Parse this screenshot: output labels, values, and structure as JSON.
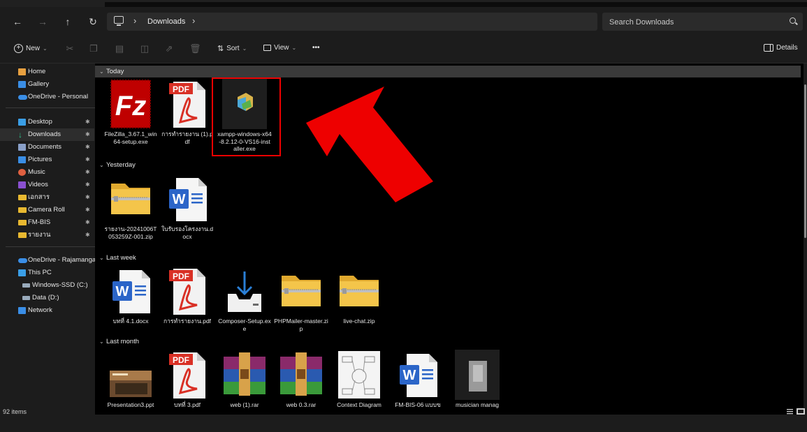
{
  "address": {
    "location_icon": "pc-icon",
    "path": [
      "Downloads"
    ]
  },
  "search": {
    "placeholder": "Search Downloads"
  },
  "commands": {
    "new": "New",
    "sort": "Sort",
    "view": "View",
    "more": "•••",
    "details": "Details"
  },
  "sidebar": {
    "items": [
      {
        "label": "Home",
        "icon": "home-icon",
        "color": "#e8a040"
      },
      {
        "label": "Gallery",
        "icon": "gallery-icon",
        "color": "#3a8ee6"
      },
      {
        "label": "OneDrive - Personal",
        "icon": "cloud-icon",
        "color": "#3a8ee6"
      },
      {
        "label": "Desktop",
        "icon": "desktop-icon",
        "color": "#3a9ee6",
        "pinned": true
      },
      {
        "label": "Downloads",
        "icon": "download-icon",
        "color": "#2dc48a",
        "pinned": true,
        "selected": true
      },
      {
        "label": "Documents",
        "icon": "document-icon",
        "color": "#8aa0c8",
        "pinned": true
      },
      {
        "label": "Pictures",
        "icon": "pictures-icon",
        "color": "#3a8ee6",
        "pinned": true
      },
      {
        "label": "Music",
        "icon": "music-icon",
        "color": "#e06040",
        "pinned": true
      },
      {
        "label": "Videos",
        "icon": "videos-icon",
        "color": "#8a50d0",
        "pinned": true
      },
      {
        "label": "เอกสาร",
        "icon": "folder-icon",
        "color": "#e8b830",
        "pinned": true
      },
      {
        "label": "Camera Roll",
        "icon": "folder-icon",
        "color": "#e8b830",
        "pinned": true
      },
      {
        "label": "FM-BIS",
        "icon": "folder-icon",
        "color": "#e8b830",
        "pinned": true
      },
      {
        "label": "รายงาน",
        "icon": "folder-icon",
        "color": "#e8b830",
        "pinned": true
      },
      {
        "label": "OneDrive - Rajamangal",
        "icon": "cloud-icon",
        "color": "#3a8ee6"
      },
      {
        "label": "This PC",
        "icon": "pc-icon",
        "color": "#3a9ee6"
      },
      {
        "label": "Windows-SSD (C:)",
        "icon": "drive-icon",
        "color": "#9ab"
      },
      {
        "label": "Data (D:)",
        "icon": "drive-icon",
        "color": "#9ab"
      },
      {
        "label": "Network",
        "icon": "network-icon",
        "color": "#3a8ee6"
      }
    ]
  },
  "groups": [
    {
      "label": "Today",
      "files": [
        {
          "name": "FileZilla_3.67.1_win64-setup.exe",
          "type": "filezilla"
        },
        {
          "name": "การทำรายงาน (1).pdf",
          "type": "pdf"
        },
        {
          "name": "xampp-windows-x64-8.2.12-0-VS16-installer.exe",
          "type": "xampp"
        }
      ]
    },
    {
      "label": "Yesterday",
      "files": [
        {
          "name": "รายงาน-20241006T053259Z-001.zip",
          "type": "zip"
        },
        {
          "name": "ใบรับรองโครงงาน.docx",
          "type": "word"
        }
      ]
    },
    {
      "label": "Last week",
      "files": [
        {
          "name": "บทที่ 4.1.docx",
          "type": "word"
        },
        {
          "name": "การทำรายงาน.pdf",
          "type": "pdf"
        },
        {
          "name": "Composer-Setup.exe",
          "type": "composer"
        },
        {
          "name": "PHPMailer-master.zip",
          "type": "zip"
        },
        {
          "name": "live-chat.zip",
          "type": "zip"
        }
      ]
    },
    {
      "label": "Last month",
      "files": [
        {
          "name": "Presentation3.ppt",
          "type": "ppt"
        },
        {
          "name": "บทที่ 3.pdf",
          "type": "pdf"
        },
        {
          "name": "web (1).rar",
          "type": "rar"
        },
        {
          "name": "web 0.3.rar",
          "type": "rar"
        },
        {
          "name": "Context Diagram",
          "type": "diagram"
        },
        {
          "name": "FM-BIS-06 แบบข",
          "type": "word"
        },
        {
          "name": "musician manag",
          "type": "generic"
        }
      ]
    }
  ],
  "status": {
    "count": "92 items"
  },
  "annotation": {
    "arrow_color": "#ee0000",
    "highlight_color": "#ee0000"
  },
  "colors": {
    "pdf_red": "#d93025",
    "word_blue": "#2b65c8",
    "folder_yellow": "#f4c54a"
  }
}
